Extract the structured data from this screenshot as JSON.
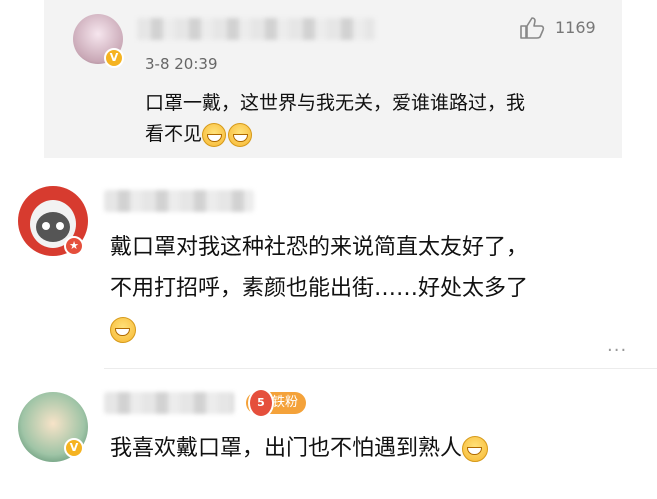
{
  "comments": [
    {
      "time": "3-8 20:39",
      "likes": "1169",
      "text_line1": "口罩一戴，这世界与我无关，爱谁谁路过，我",
      "text_line2": "看不见"
    },
    {
      "text_line1": "戴口罩对我这种社恐的来说简直太友好了，",
      "text_line2": "不用打招呼，素颜也能出街……好处太多了"
    },
    {
      "badge_level": "5",
      "badge_label": "铁粉",
      "text": "我喜欢戴口罩，出门也不怕遇到熟人"
    }
  ],
  "icons": {
    "like": "thumbs-up-icon",
    "verified": "verified-v-icon",
    "more": "more-dots-icon",
    "emoji": "grin-emoji-icon",
    "emoji_laugh": "laughing-emoji-icon"
  },
  "colors": {
    "reply_bg": "#f3f3f3",
    "verified": "#f5b321",
    "fan_badge": "#f4a23a"
  }
}
